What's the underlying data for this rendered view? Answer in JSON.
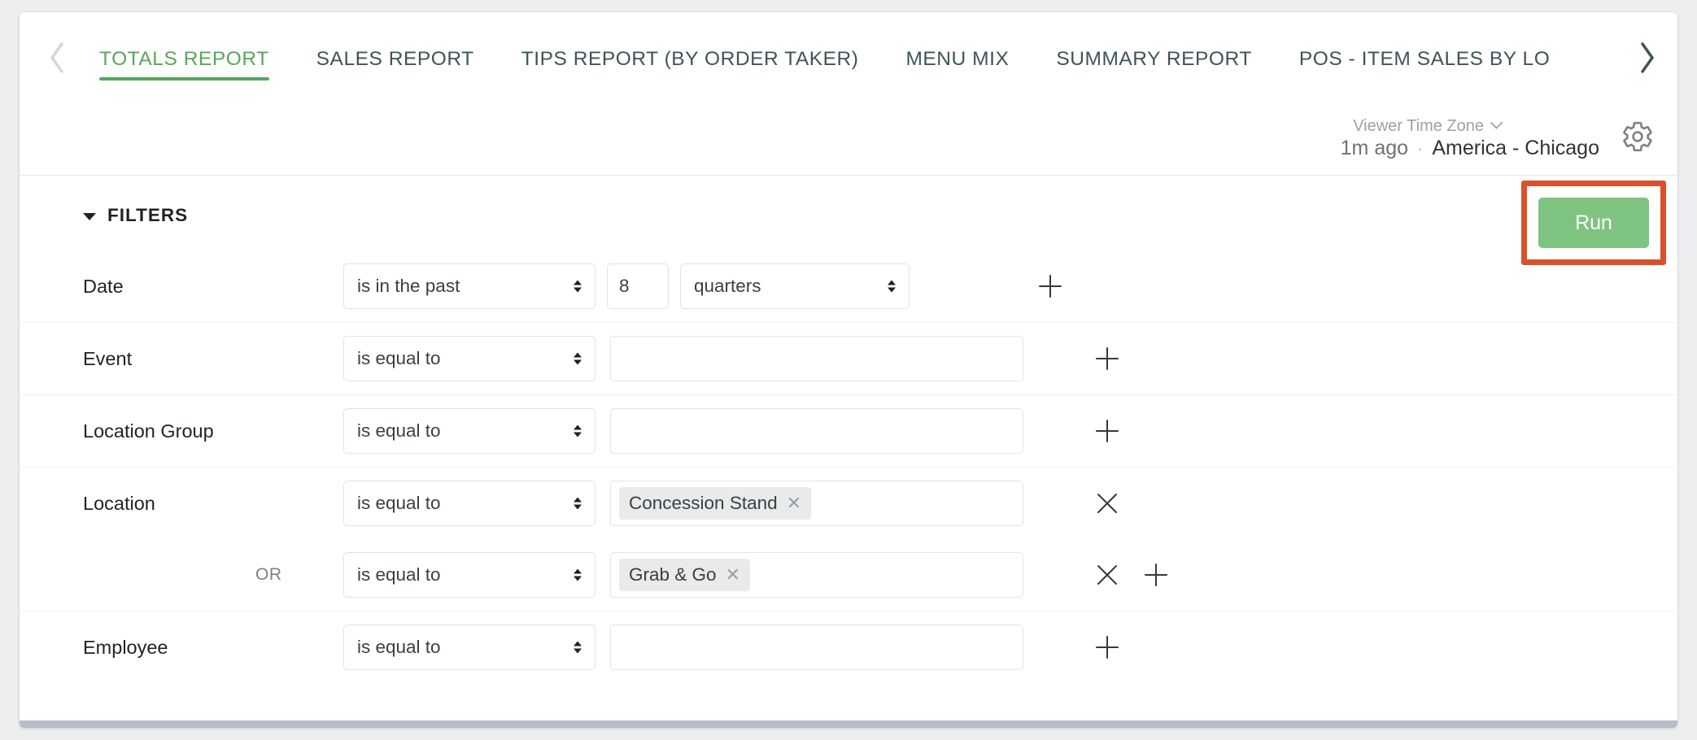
{
  "tabs": {
    "prev_icon": "chevron-left-icon",
    "next_icon": "chevron-right-icon",
    "items": [
      {
        "label": "TOTALS REPORT",
        "active": true
      },
      {
        "label": "SALES REPORT",
        "active": false
      },
      {
        "label": "TIPS REPORT (BY ORDER TAKER)",
        "active": false
      },
      {
        "label": "MENU MIX",
        "active": false
      },
      {
        "label": "SUMMARY REPORT",
        "active": false
      },
      {
        "label": "POS - ITEM SALES BY LO",
        "active": false
      }
    ],
    "active_color": "#56a85a"
  },
  "meta": {
    "timezone_label": "Viewer Time Zone",
    "timezone_caret": "⌄",
    "last_run": "1m ago",
    "separator": "·",
    "timezone_value": "America - Chicago",
    "settings_icon": "gear-icon"
  },
  "filters": {
    "section_title": "FILTERS",
    "collapse_icon": "triangle-down-icon",
    "run_label": "Run",
    "run_color": "#7ec480",
    "highlight_color": "#d9512c",
    "add_icon": "plus-icon",
    "remove_icon": "close-x-icon",
    "or_label": "OR",
    "rows": [
      {
        "label": "Date",
        "operator": "is in the past",
        "amount": "8",
        "unit": "quarters",
        "action": "add"
      },
      {
        "label": "Event",
        "operator": "is equal to",
        "value_placeholder": "",
        "tokens": [],
        "action": "add"
      },
      {
        "label": "Location Group",
        "operator": "is equal to",
        "value_placeholder": "",
        "tokens": [],
        "action": "add"
      },
      {
        "label": "Location",
        "operator": "is equal to",
        "value_placeholder": "",
        "tokens": [
          "Concession Stand"
        ],
        "action": "remove",
        "or_rows": [
          {
            "connector": "OR",
            "operator": "is equal to",
            "value_placeholder": "",
            "tokens": [
              "Grab & Go"
            ],
            "action": "remove-add"
          }
        ]
      },
      {
        "label": "Employee",
        "operator": "is equal to",
        "value_placeholder": "",
        "tokens": [],
        "action": "add"
      }
    ]
  }
}
